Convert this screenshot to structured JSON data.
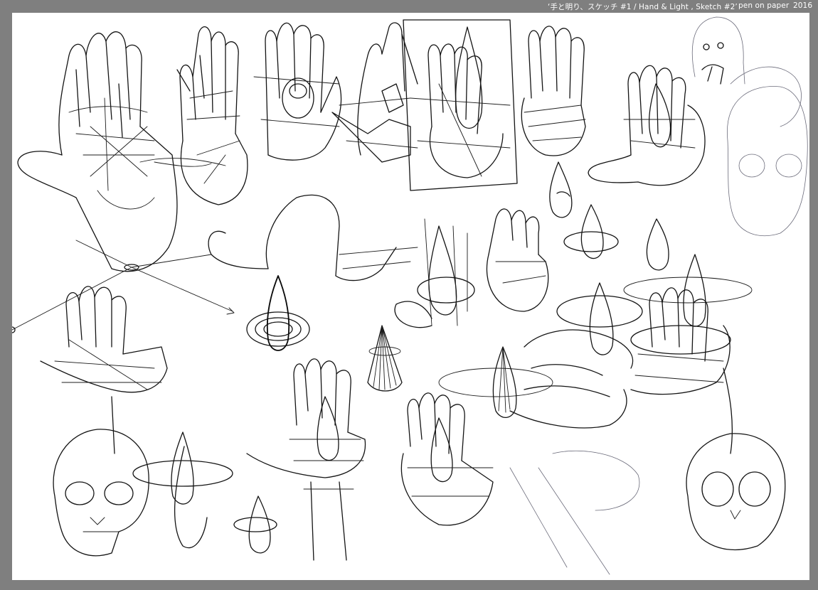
{
  "caption": {
    "title": "‘手と明り、スケッチ #1 /  Hand & Light , Sketch  #2’",
    "medium": "pen on paper",
    "year": "2016"
  },
  "artwork": {
    "subjects": [
      "hand-sketch",
      "flame-sketch",
      "skull-sketch",
      "ghost-sketch"
    ],
    "ink_color": "#141414",
    "paper_color": "#ffffff",
    "frame_color": "#7f7f7f"
  }
}
